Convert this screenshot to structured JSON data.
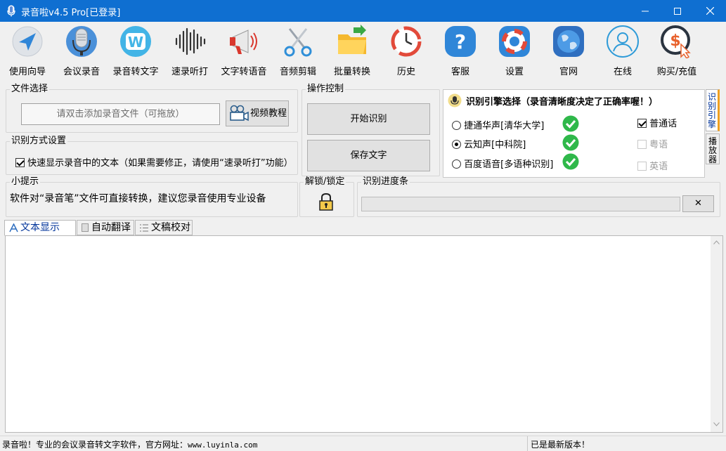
{
  "window": {
    "title": "录音啦v4.5 Pro[已登录]",
    "minimize": "—",
    "maximize": "☐",
    "close": "✕"
  },
  "toolbar": {
    "items": [
      {
        "label": "使用向导",
        "icon": "navigation-arrow-icon"
      },
      {
        "label": "会议录音",
        "icon": "microphone-icon"
      },
      {
        "label": "录音转文字",
        "icon": "w-logo-icon"
      },
      {
        "label": "速录听打",
        "icon": "sound-wave-icon"
      },
      {
        "label": "文字转语音",
        "icon": "megaphone-icon"
      },
      {
        "label": "音频剪辑",
        "icon": "scissors-icon"
      },
      {
        "label": "批量转换",
        "icon": "folder-icon"
      },
      {
        "label": "历史",
        "icon": "history-clock-icon"
      },
      {
        "label": "客服",
        "icon": "help-icon"
      },
      {
        "label": "设置",
        "icon": "lifebuoy-icon"
      },
      {
        "label": "官网",
        "icon": "globe-icon"
      },
      {
        "label": "在线",
        "icon": "user-icon"
      },
      {
        "label": "购买/充值",
        "icon": "dollar-coin-icon"
      }
    ]
  },
  "file_select": {
    "title": "文件选择",
    "drop_placeholder": "请双击添加录音文件（可拖放）",
    "video_button": "视频教程"
  },
  "recognition_mode": {
    "title": "识别方式设置",
    "quick_display_label": "快速显示录音中的文本（如果需要修正，请使用“速录听打”功能）",
    "quick_display_checked": true
  },
  "operation": {
    "title": "操作控制",
    "start_button": "开始识别",
    "save_button": "保存文字"
  },
  "engine": {
    "title": "识别引擎选择（录音清晰度决定了正确率喔！）",
    "options": [
      {
        "label": "捷通华声[清华大学]",
        "selected": false
      },
      {
        "label": "云知声[中科院]",
        "selected": true
      },
      {
        "label": "百度语音[多语种识别]",
        "selected": false
      }
    ],
    "languages": [
      {
        "label": "普通话",
        "checked": true,
        "enabled": true
      },
      {
        "label": "粤语",
        "checked": false,
        "enabled": false
      },
      {
        "label": "英语",
        "checked": false,
        "enabled": false
      }
    ],
    "side_tabs": [
      "识别引擎",
      "播放器"
    ]
  },
  "tips": {
    "title": "小提示",
    "text": "软件对“录音笔”文件可直接转换，建议您录音使用专业设备"
  },
  "lock": {
    "title": "解锁/锁定"
  },
  "progress": {
    "title": "识别进度条",
    "value": 0,
    "cancel": "✕"
  },
  "tabs": [
    {
      "label": "文本显示",
      "active": true
    },
    {
      "label": "自动翻译",
      "active": false
    },
    {
      "label": "文稿校对",
      "active": false
    }
  ],
  "statusbar": {
    "left": "录音啦！专业的会议录音转文字软件，官方网址：",
    "url": "www.luyinla.com",
    "right": "已是最新版本！"
  },
  "colors": {
    "titlebar": "#0f6fd1",
    "check_green": "#2fb84a",
    "accent_blue": "#2f86d8"
  }
}
